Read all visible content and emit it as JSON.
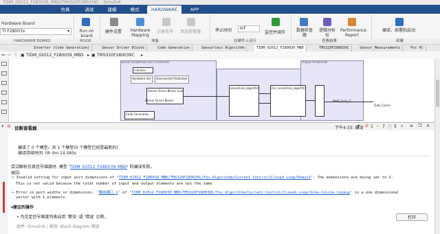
{
  "window_title": "TIDM_02012_F280039_MBD/TMS320F280039C - Simulink",
  "ribbon_tabs": [
    "仿真",
    "调试",
    "建模",
    "格式",
    "HARDWARE",
    "APP"
  ],
  "hardware_board": {
    "label": "Hardware Board",
    "value": "TI F28003x"
  },
  "ribbon": {
    "run_on_board": "Run on board",
    "hardware_settings": "硬件设置",
    "hardware_mapping": "Hardware Mapping",
    "log_signal": "记录信号",
    "add_viewer": "添加查看器",
    "stop_time_label": "停止时间",
    "stop_time_value": "Inf",
    "monitor_tune": "监控并调节",
    "data_inspector": "数据检查器",
    "logic_analyzer": "逻辑分析仪",
    "performance_report": "Performance Report",
    "build_deploy_start": "编译、部署和启动"
  },
  "group_labels": [
    "HARDWARE BOARD",
    "MODE",
    "准备",
    "在硬件上运行",
    "查看结果",
    "部署"
  ],
  "doc_tabs": [
    "Inverter (Code Generation)",
    "Sensor Driver Blocks",
    "Code Generation",
    "Sensorless Algorithm",
    "TIDM_02012_F280039_MBD",
    "TMS320F280039C",
    "Sensor_Measurements",
    "Foc Al"
  ],
  "explorer_path": [
    "TIDM_02012_F280039_MBD",
    "TMS320F280039C"
  ],
  "canvas": {
    "blocks": [
      "initialize",
      "Hardware Init",
      "Overcurrent Protection Logic",
      "Sensor Driver Blocks (Lookup)",
      "Sensor Driver Blocks",
      "Code Generation",
      "sensorless_algorithm",
      "Foc_sensorless_algorithm",
      "PWM_Duty_Cycles",
      "Duty Cycles",
      "Output Peripherals",
      "Sensor Peripherals and Commands"
    ]
  },
  "diagnostics": {
    "title": "诊断查看器",
    "timestamp": "下午4:33: 编译",
    "errors": "1",
    "warnings": "7",
    "info": "5",
    "build_line1": "编译了 0 个模型。共 1 个模型(0 个模型已经是最新的)",
    "build_line2": "编译持续时间: 0h 0m 14.085s",
    "fail_prefix": "尝试解析仿真信号维度时, 模型 '",
    "fail_model": "TIDM_02012_F280039_MBD",
    "fail_suffix": "' 的编译失败。",
    "cause_label": "原因:",
    "error1_bullet": "Invalid setting for input port dimensions of '",
    "error1_link": "TIDM_02012_F280039_MBD/TMS320F280039C/Foc  Algorithm/Current Control/Closed Loop/Demux3",
    "error1_tail": "'. The dimensions are being set to 1.",
    "error1_line2": "This is not valid because the total number of input and output elements are not the same",
    "error2_prefix": "Error in port widths or dimensions. '",
    "error2_port": "输出端口 1",
    "error2_mid": "' of '",
    "error2_link": "TIDM_02012_F280039_MBD/TMS320F280039C/Foc  Algorithm/Current Control/Closed Loop/Sine-Cosine Lookup",
    "error2_tail": "' is a one dimensional",
    "error2_line2": "vector with 1 elements.",
    "suggested_header": "建议的操作",
    "suggested_action": "为交定信号维度列表启用 '警告' 或 '错误' 诊断。",
    "open_button": "打开",
    "footer": "组件: Simulink | 类别: Block diagram 错误"
  }
}
